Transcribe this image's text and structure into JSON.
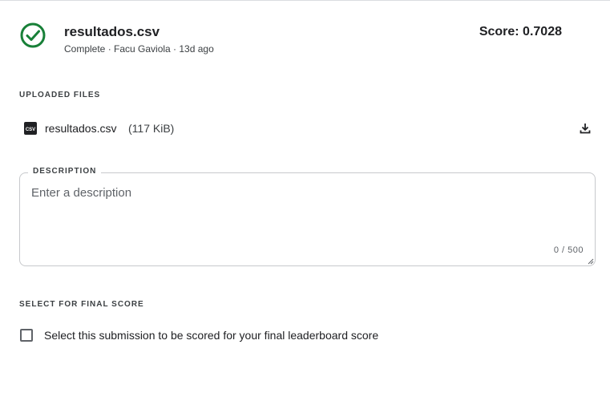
{
  "submission": {
    "file_name": "resultados.csv",
    "meta": "Complete · Facu Gaviola · 13d ago",
    "score": "Score: 0.7028",
    "status_icon": "check-circle-icon",
    "status_color": "#188038"
  },
  "uploaded_files": {
    "label": "UPLOADED FILES",
    "files": [
      {
        "name": "resultados.csv",
        "size": "(117 KiB)",
        "icon": "csv-file-icon",
        "action_icon": "download-icon"
      }
    ]
  },
  "description": {
    "label": "DESCRIPTION",
    "value": "",
    "placeholder": "Enter a description",
    "char_count": "0 / 500"
  },
  "final_score": {
    "label": "SELECT FOR FINAL SCORE",
    "checkbox_label": "Select this submission to be scored for your final leaderboard score",
    "checked": false
  }
}
